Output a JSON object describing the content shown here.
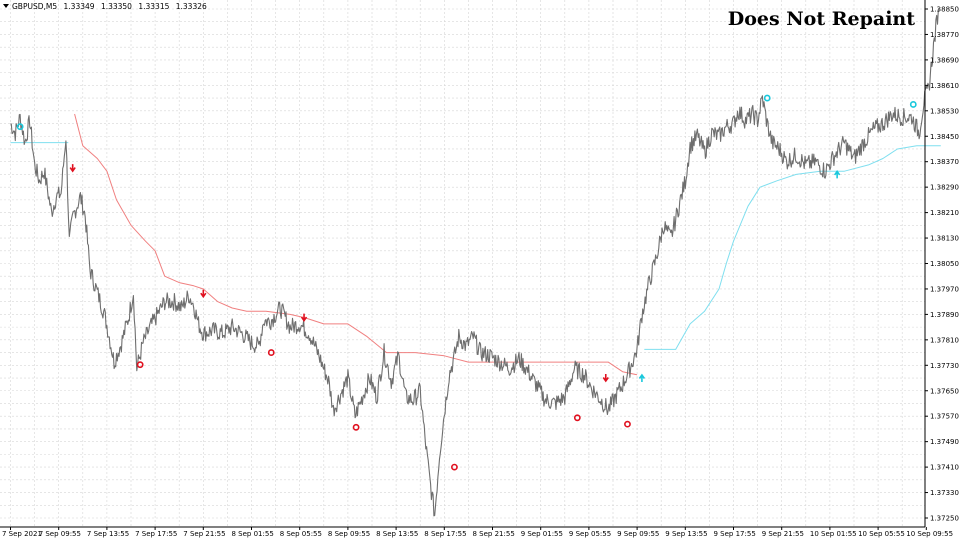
{
  "watermark": "Does Not Repaint",
  "chart_data": {
    "type": "line",
    "symbol_info": {
      "symbol": "GBPUSD,M5",
      "open": "1.33349",
      "high": "1.33350",
      "low": "1.33315",
      "close": "1.33326"
    },
    "x_tick_labels": [
      "7 Sep 2021",
      "7 Sep 09:55",
      "7 Sep 13:55",
      "7 Sep 17:55",
      "7 Sep 21:55",
      "8 Sep 01:55",
      "8 Sep 05:55",
      "8 Sep 09:55",
      "8 Sep 13:55",
      "8 Sep 17:55",
      "8 Sep 21:55",
      "9 Sep 01:55",
      "9 Sep 05:55",
      "9 Sep 09:55",
      "9 Sep 13:55",
      "9 Sep 17:55",
      "9 Sep 21:55",
      "10 Sep 01:55",
      "10 Sep 05:55",
      "10 Sep 09:55"
    ],
    "y_tick_labels": [
      "1.38850",
      "1.38770",
      "1.38690",
      "1.38610",
      "1.38530",
      "1.38450",
      "1.38370",
      "1.38290",
      "1.38210",
      "1.38130",
      "1.38050",
      "1.37970",
      "1.37890",
      "1.37810",
      "1.37730",
      "1.37650",
      "1.37570",
      "1.37490",
      "1.37410",
      "1.37330",
      "1.37250"
    ],
    "ylim": [
      1.3722,
      1.3887
    ],
    "x_range": [
      0,
      19
    ],
    "grid": true,
    "colors": {
      "price": "#6e6e6e",
      "resistance": "#f08080",
      "support": "#7fdfef",
      "sell_signal": "#e0101f",
      "buy_signal": "#19c8dc",
      "grid": "#d6d6d6",
      "axis": "#000000"
    },
    "series": [
      {
        "key": "price",
        "points": [
          [
            0,
            1.3849
          ],
          [
            0.1,
            1.3846
          ],
          [
            0.2,
            1.3851
          ],
          [
            0.3,
            1.3843
          ],
          [
            0.4,
            1.385
          ],
          [
            0.5,
            1.3836
          ],
          [
            0.6,
            1.3831
          ],
          [
            0.7,
            1.3834
          ],
          [
            0.85,
            1.3821
          ],
          [
            0.95,
            1.3826
          ],
          [
            1.05,
            1.3827
          ],
          [
            1.15,
            1.3845
          ],
          [
            1.22,
            1.3812
          ],
          [
            1.3,
            1.382
          ],
          [
            1.45,
            1.3826
          ],
          [
            1.55,
            1.382
          ],
          [
            1.65,
            1.3803
          ],
          [
            1.8,
            1.3796
          ],
          [
            1.95,
            1.3789
          ],
          [
            2.05,
            1.3782
          ],
          [
            2.15,
            1.3774
          ],
          [
            2.3,
            1.378
          ],
          [
            2.45,
            1.3788
          ],
          [
            2.55,
            1.3796
          ],
          [
            2.62,
            1.3772
          ],
          [
            2.75,
            1.378
          ],
          [
            2.9,
            1.3785
          ],
          [
            3.05,
            1.3789
          ],
          [
            3.2,
            1.3793
          ],
          [
            3.4,
            1.3793
          ],
          [
            3.55,
            1.3791
          ],
          [
            3.7,
            1.3795
          ],
          [
            3.8,
            1.3792
          ],
          [
            3.9,
            1.3786
          ],
          [
            4.0,
            1.3783
          ],
          [
            4.2,
            1.3784
          ],
          [
            4.4,
            1.3783
          ],
          [
            4.6,
            1.3785
          ],
          [
            4.8,
            1.3783
          ],
          [
            5.0,
            1.378
          ],
          [
            5.15,
            1.3779
          ],
          [
            5.25,
            1.3787
          ],
          [
            5.4,
            1.3787
          ],
          [
            5.6,
            1.3791
          ],
          [
            5.8,
            1.3785
          ],
          [
            6.0,
            1.3786
          ],
          [
            6.2,
            1.3783
          ],
          [
            6.4,
            1.3776
          ],
          [
            6.6,
            1.3768
          ],
          [
            6.7,
            1.3759
          ],
          [
            6.85,
            1.3764
          ],
          [
            7.0,
            1.3769
          ],
          [
            7.15,
            1.3757
          ],
          [
            7.3,
            1.3763
          ],
          [
            7.45,
            1.3769
          ],
          [
            7.6,
            1.3763
          ],
          [
            7.75,
            1.3777
          ],
          [
            7.9,
            1.3768
          ],
          [
            8.05,
            1.3776
          ],
          [
            8.2,
            1.3763
          ],
          [
            8.35,
            1.3762
          ],
          [
            8.5,
            1.3765
          ],
          [
            8.6,
            1.375
          ],
          [
            8.7,
            1.3737
          ],
          [
            8.8,
            1.3726
          ],
          [
            8.9,
            1.3745
          ],
          [
            9.0,
            1.3758
          ],
          [
            9.1,
            1.377
          ],
          [
            9.2,
            1.3775
          ],
          [
            9.3,
            1.3782
          ],
          [
            9.45,
            1.3779
          ],
          [
            9.6,
            1.3782
          ],
          [
            9.75,
            1.3777
          ],
          [
            9.95,
            1.3776
          ],
          [
            10.15,
            1.3774
          ],
          [
            10.35,
            1.3772
          ],
          [
            10.55,
            1.3775
          ],
          [
            10.7,
            1.3772
          ],
          [
            10.9,
            1.3767
          ],
          [
            11.1,
            1.3762
          ],
          [
            11.3,
            1.3761
          ],
          [
            11.5,
            1.3763
          ],
          [
            11.7,
            1.3772
          ],
          [
            11.9,
            1.377
          ],
          [
            12.05,
            1.3766
          ],
          [
            12.2,
            1.3763
          ],
          [
            12.4,
            1.3759
          ],
          [
            12.55,
            1.3763
          ],
          [
            12.7,
            1.3767
          ],
          [
            12.85,
            1.3772
          ],
          [
            13.0,
            1.3778
          ],
          [
            13.1,
            1.3789
          ],
          [
            13.25,
            1.3799
          ],
          [
            13.4,
            1.3807
          ],
          [
            13.55,
            1.3817
          ],
          [
            13.7,
            1.3813
          ],
          [
            13.85,
            1.3822
          ],
          [
            14.0,
            1.3831
          ],
          [
            14.1,
            1.3842
          ],
          [
            14.25,
            1.3845
          ],
          [
            14.4,
            1.384
          ],
          [
            14.55,
            1.3846
          ],
          [
            14.7,
            1.3845
          ],
          [
            14.85,
            1.3848
          ],
          [
            15.0,
            1.3849
          ],
          [
            15.1,
            1.3853
          ],
          [
            15.25,
            1.385
          ],
          [
            15.4,
            1.3852
          ],
          [
            15.5,
            1.385
          ],
          [
            15.6,
            1.3857
          ],
          [
            15.7,
            1.3849
          ],
          [
            15.8,
            1.3843
          ],
          [
            15.95,
            1.3841
          ],
          [
            16.1,
            1.3837
          ],
          [
            16.3,
            1.3839
          ],
          [
            16.5,
            1.3836
          ],
          [
            16.7,
            1.3837
          ],
          [
            16.9,
            1.3834
          ],
          [
            17.1,
            1.3839
          ],
          [
            17.3,
            1.3843
          ],
          [
            17.5,
            1.3838
          ],
          [
            17.7,
            1.3843
          ],
          [
            17.9,
            1.3847
          ],
          [
            18.1,
            1.3849
          ],
          [
            18.3,
            1.3852
          ],
          [
            18.5,
            1.3851
          ],
          [
            18.7,
            1.3851
          ],
          [
            18.85,
            1.3846
          ],
          [
            18.95,
            1.3856
          ],
          [
            19.05,
            1.386
          ],
          [
            19.15,
            1.3873
          ],
          [
            19.25,
            1.3885
          ]
        ]
      },
      {
        "key": "resistance",
        "points": [
          [
            1.33,
            1.3852
          ],
          [
            1.5,
            1.3842
          ],
          [
            1.8,
            1.3838
          ],
          [
            2.0,
            1.3834
          ],
          [
            2.2,
            1.3825
          ],
          [
            2.5,
            1.3817
          ],
          [
            2.8,
            1.3812
          ],
          [
            3.0,
            1.3809
          ],
          [
            3.2,
            1.3801
          ],
          [
            3.5,
            1.3799
          ],
          [
            3.8,
            1.3798
          ],
          [
            4.0,
            1.3797
          ],
          [
            4.3,
            1.3793
          ],
          [
            4.6,
            1.3791
          ],
          [
            4.9,
            1.379
          ],
          [
            5.3,
            1.379
          ],
          [
            5.8,
            1.3789
          ],
          [
            6.1,
            1.3788
          ],
          [
            6.5,
            1.3786
          ],
          [
            7.0,
            1.3786
          ],
          [
            7.4,
            1.3782
          ],
          [
            7.8,
            1.3777
          ],
          [
            8.4,
            1.3777
          ],
          [
            9.0,
            1.3776
          ],
          [
            9.5,
            1.3774
          ],
          [
            10.0,
            1.3774
          ],
          [
            11.0,
            1.3774
          ],
          [
            12.0,
            1.3774
          ],
          [
            12.4,
            1.3774
          ],
          [
            12.7,
            1.3771
          ],
          [
            13.0,
            1.377
          ]
        ]
      },
      {
        "key": "support",
        "points": [
          [
            0,
            1.3843
          ],
          [
            0.5,
            1.3843
          ],
          [
            1.0,
            1.3843
          ],
          [
            1.2,
            1.3843
          ],
          [
            13.15,
            1.3778
          ],
          [
            13.8,
            1.3778
          ],
          [
            14.1,
            1.3786
          ],
          [
            14.4,
            1.379
          ],
          [
            14.7,
            1.3797
          ],
          [
            14.85,
            1.3805
          ],
          [
            15.0,
            1.3812
          ],
          [
            15.3,
            1.3823
          ],
          [
            15.55,
            1.3829
          ],
          [
            15.9,
            1.3831
          ],
          [
            16.3,
            1.3833
          ],
          [
            16.8,
            1.3834
          ],
          [
            17.3,
            1.3834
          ],
          [
            17.8,
            1.3836
          ],
          [
            18.1,
            1.3838
          ],
          [
            18.4,
            1.3841
          ],
          [
            18.8,
            1.3842
          ],
          [
            19.3,
            1.3842
          ]
        ]
      }
    ],
    "signals": [
      {
        "type": "sell",
        "marker": "arrow-down",
        "x": 1.29,
        "y": 1.3835
      },
      {
        "type": "sell",
        "marker": "arrow-down",
        "x": 4.0,
        "y": 1.37955
      },
      {
        "type": "sell",
        "marker": "arrow-down",
        "x": 6.09,
        "y": 1.3788
      },
      {
        "type": "sell",
        "marker": "arrow-down",
        "x": 12.35,
        "y": 1.3769
      },
      {
        "type": "sell",
        "marker": "circle",
        "x": 2.69,
        "y": 1.37732
      },
      {
        "type": "sell",
        "marker": "circle",
        "x": 5.41,
        "y": 1.3777
      },
      {
        "type": "sell",
        "marker": "circle",
        "x": 7.17,
        "y": 1.37535
      },
      {
        "type": "sell",
        "marker": "circle",
        "x": 9.21,
        "y": 1.3741
      },
      {
        "type": "sell",
        "marker": "circle",
        "x": 11.76,
        "y": 1.37565
      },
      {
        "type": "sell",
        "marker": "circle",
        "x": 12.8,
        "y": 1.37545
      },
      {
        "type": "buy",
        "marker": "arrow-up",
        "x": 13.1,
        "y": 1.3769
      },
      {
        "type": "buy",
        "marker": "arrow-up",
        "x": 17.15,
        "y": 1.3833
      },
      {
        "type": "buy",
        "marker": "circle",
        "x": 0.2,
        "y": 1.3848
      },
      {
        "type": "buy",
        "marker": "circle",
        "x": 15.7,
        "y": 1.3857
      },
      {
        "type": "buy",
        "marker": "circle",
        "x": 18.73,
        "y": 1.3855
      }
    ]
  }
}
